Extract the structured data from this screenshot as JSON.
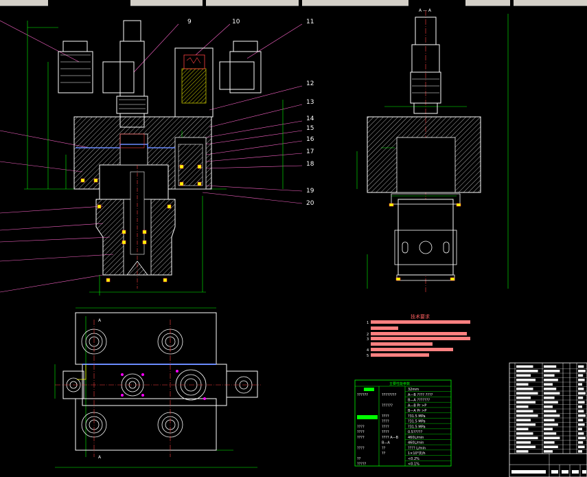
{
  "toolbar": {
    "segments": 6
  },
  "section_label": "A — A",
  "part_numbers": [
    "9",
    "10",
    "11",
    "12",
    "13",
    "14",
    "15",
    "16",
    "17",
    "18",
    "19",
    "20"
  ],
  "view_marks": [
    "A",
    "A"
  ],
  "tech_requirements": {
    "title": "技术要求",
    "items": [
      "1",
      "2",
      "3",
      "4",
      "5"
    ]
  },
  "perf_table": {
    "title": "主要性能参数",
    "rows": [
      {
        "label": "",
        "col2": "",
        "col3": "32mm"
      },
      {
        "label": "??????",
        "col2": "????????",
        "col3": "A—B  ???? ????"
      },
      {
        "label": "",
        "col2": "",
        "col3": "B—A  ???????"
      },
      {
        "label": "",
        "col2": "??????",
        "col3": "A—B  Pr >P"
      },
      {
        "label": "",
        "col2": "",
        "col3": "B—A  Pr >P"
      },
      {
        "label": "",
        "col2": "????",
        "col3": "?31.5 MPa"
      },
      {
        "label": "",
        "col2": "????",
        "col3": "?31.5 MPa"
      },
      {
        "label": "????",
        "col2": "????",
        "col3": "?31.5 MPa"
      },
      {
        "label": "????",
        "col2": "????",
        "col3": "0.5?????"
      },
      {
        "label": "????",
        "col2": "????  A—B",
        "col3": "460L/min"
      },
      {
        "label": "",
        "col2": "B—A",
        "col3": "460L/min"
      },
      {
        "label": "????",
        "col2": "??",
        "col3": "???? L/min"
      },
      {
        "label": "",
        "col2": "??",
        "col3": "1×10⁵次/h"
      },
      {
        "label": "??",
        "col2": "",
        "col3": "<0.2%"
      },
      {
        "label": "?????",
        "col2": "",
        "col3": "<0.1%"
      }
    ]
  },
  "colors": {
    "background": "#000000",
    "outline": "#ffffff",
    "dimension": "#00ff00",
    "hatch": "#ffffff",
    "leader": "#ff66cc",
    "center": "#ff4040",
    "blue": "#6b8cff",
    "yellow": "#ffff00",
    "salmon": "#ff8080",
    "magenta": "#ff00ff"
  }
}
